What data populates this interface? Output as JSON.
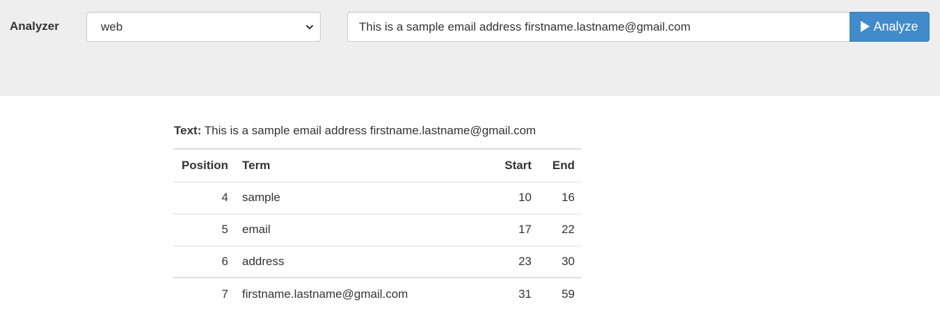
{
  "header": {
    "analyzer_label": "Analyzer",
    "analyzer_selected": "web",
    "text_input_value": "This is a sample email address firstname.lastname@gmail.com",
    "analyze_button_label": "Analyze",
    "accent_color": "#428bca"
  },
  "result": {
    "text_label": "Text:",
    "text_value": "This is a sample email address firstname.lastname@gmail.com",
    "columns": {
      "position": "Position",
      "term": "Term",
      "start": "Start",
      "end": "End"
    },
    "rows": [
      {
        "position": "4",
        "term": "sample",
        "start": "10",
        "end": "16"
      },
      {
        "position": "5",
        "term": "email",
        "start": "17",
        "end": "22"
      },
      {
        "position": "6",
        "term": "address",
        "start": "23",
        "end": "30"
      },
      {
        "position": "7",
        "term": "firstname.lastname@gmail.com",
        "start": "31",
        "end": "59"
      }
    ]
  },
  "icons": {
    "select_chevron": "chevron-down-icon",
    "analyze": "play-icon"
  }
}
